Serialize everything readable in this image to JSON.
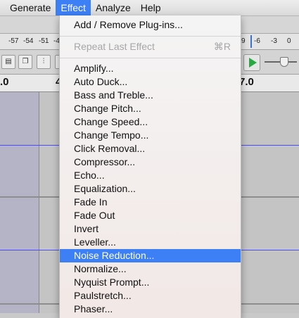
{
  "menubar": {
    "items": [
      "Generate",
      "Effect",
      "Analyze",
      "Help"
    ],
    "active": "Effect"
  },
  "meter": {
    "ticks_left": [
      "-57",
      "-54",
      "-51",
      "-4"
    ],
    "ticks_right": [
      "9",
      "-6",
      "-3",
      "0"
    ]
  },
  "ruler": {
    "left_label": ".0",
    "mid_label": "4",
    "right_label": "7.0"
  },
  "effect_menu": {
    "add_remove": "Add / Remove Plug-ins...",
    "repeat_last": "Repeat Last Effect",
    "repeat_shortcut": "⌘R",
    "items": [
      "Amplify...",
      "Auto Duck...",
      "Bass and Treble...",
      "Change Pitch...",
      "Change Speed...",
      "Change Tempo...",
      "Click Removal...",
      "Compressor...",
      "Echo...",
      "Equalization...",
      "Fade In",
      "Fade Out",
      "Invert",
      "Leveller...",
      "Noise Reduction...",
      "Normalize...",
      "Nyquist Prompt...",
      "Paulstretch...",
      "Phaser..."
    ],
    "highlighted": "Noise Reduction..."
  },
  "colors": {
    "accent": "#3d7ff5",
    "waveform": "#4a4aff",
    "play": "#2aa844"
  }
}
